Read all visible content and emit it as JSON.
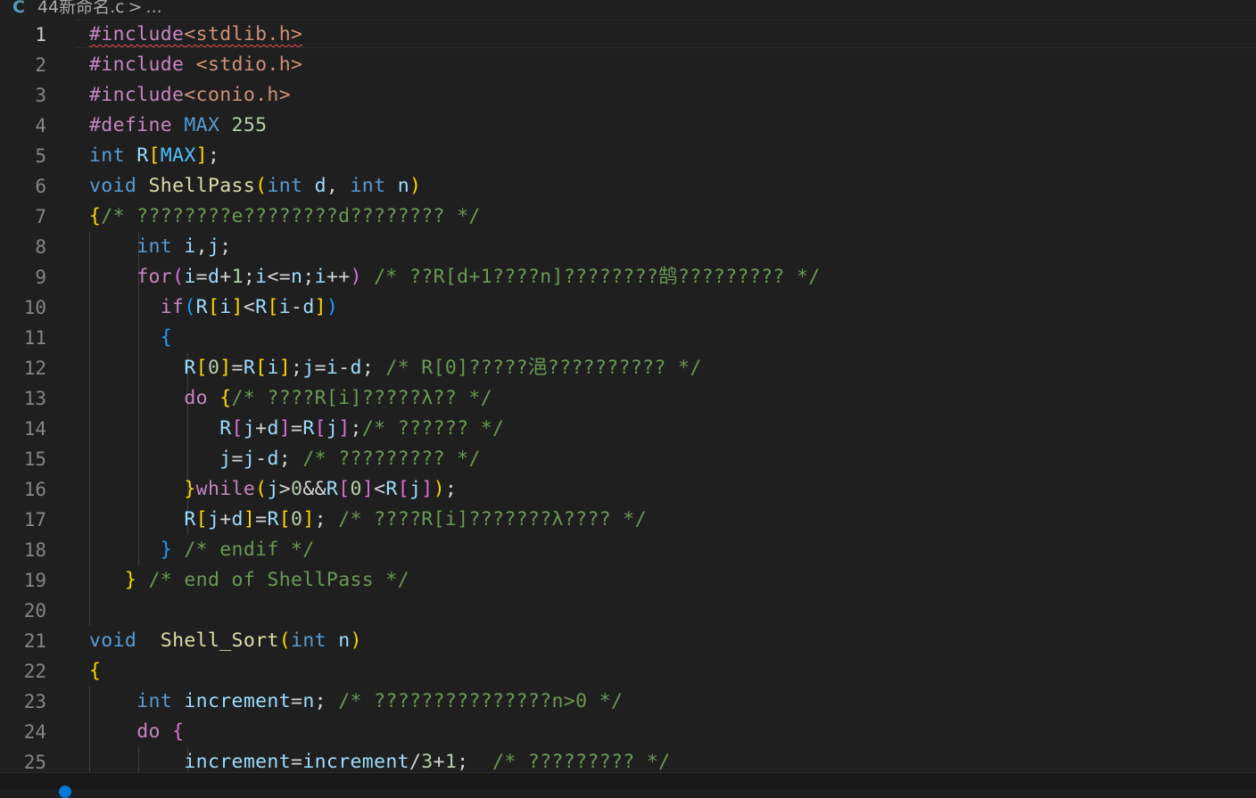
{
  "breadcrumb": {
    "icon": "C",
    "filename": "44新命名.c",
    "separator": ">",
    "more": "..."
  },
  "colors": {
    "keyword": "#569cd6",
    "control": "#c586c0",
    "function": "#dcdcaa",
    "variable": "#9cdcfe",
    "number": "#b5cea8",
    "string": "#ce9178",
    "comment": "#6a9955",
    "text": "#d4d4d4",
    "constant": "#4fc1ff",
    "bracket1": "#ffd700",
    "bracket2": "#da70d6",
    "bracket3": "#179fff"
  },
  "code_lines": [
    {
      "n": "1",
      "t": [
        [
          "#include",
          "control"
        ],
        [
          "<stdlib.h>",
          "string"
        ]
      ]
    },
    {
      "n": "2",
      "t": [
        [
          "#include",
          "control"
        ],
        [
          " ",
          "text"
        ],
        [
          "<stdio.h>",
          "string"
        ]
      ]
    },
    {
      "n": "3",
      "t": [
        [
          "#include",
          "control"
        ],
        [
          "<conio.h>",
          "string"
        ]
      ]
    },
    {
      "n": "4",
      "t": [
        [
          "#define",
          "control"
        ],
        [
          " ",
          "text"
        ],
        [
          "MAX",
          "keyword"
        ],
        [
          " ",
          "text"
        ],
        [
          "255",
          "number"
        ]
      ]
    },
    {
      "n": "5",
      "t": [
        [
          "int",
          "keyword"
        ],
        [
          " ",
          "text"
        ],
        [
          "R",
          "variable"
        ],
        [
          "[",
          "bracket1"
        ],
        [
          "MAX",
          "constant"
        ],
        [
          "]",
          "bracket1"
        ],
        [
          ";",
          "text"
        ]
      ]
    },
    {
      "n": "6",
      "t": [
        [
          "void",
          "keyword"
        ],
        [
          " ",
          "text"
        ],
        [
          "ShellPass",
          "function"
        ],
        [
          "(",
          "bracket1"
        ],
        [
          "int",
          "keyword"
        ],
        [
          " ",
          "text"
        ],
        [
          "d",
          "variable"
        ],
        [
          ", ",
          "text"
        ],
        [
          "int",
          "keyword"
        ],
        [
          " ",
          "text"
        ],
        [
          "n",
          "variable"
        ],
        [
          ")",
          "bracket1"
        ]
      ]
    },
    {
      "n": "7",
      "t": [
        [
          "{",
          "bracket1"
        ],
        [
          "/* ????????e????????d???????? */",
          "comment"
        ]
      ]
    },
    {
      "n": "8",
      "t": [
        [
          "    ",
          "text"
        ],
        [
          "int",
          "keyword"
        ],
        [
          " ",
          "text"
        ],
        [
          "i",
          "variable"
        ],
        [
          ",",
          "text"
        ],
        [
          "j",
          "variable"
        ],
        [
          ";",
          "text"
        ]
      ]
    },
    {
      "n": "9",
      "t": [
        [
          "    ",
          "text"
        ],
        [
          "for",
          "control"
        ],
        [
          "(",
          "bracket2"
        ],
        [
          "i",
          "variable"
        ],
        [
          "=",
          "text"
        ],
        [
          "d",
          "variable"
        ],
        [
          "+",
          "text"
        ],
        [
          "1",
          "number"
        ],
        [
          ";",
          "text"
        ],
        [
          "i",
          "variable"
        ],
        [
          "<=",
          "text"
        ],
        [
          "n",
          "variable"
        ],
        [
          ";",
          "text"
        ],
        [
          "i",
          "variable"
        ],
        [
          "++",
          "text"
        ],
        [
          ")",
          "bracket2"
        ],
        [
          " ",
          "text"
        ],
        [
          "/* ??R[d+1????n]????????鹄????????? */",
          "comment"
        ]
      ]
    },
    {
      "n": "10",
      "t": [
        [
          "      ",
          "text"
        ],
        [
          "if",
          "control"
        ],
        [
          "(",
          "bracket3"
        ],
        [
          "R",
          "variable"
        ],
        [
          "[",
          "bracket1"
        ],
        [
          "i",
          "variable"
        ],
        [
          "]",
          "bracket1"
        ],
        [
          "<",
          "text"
        ],
        [
          "R",
          "variable"
        ],
        [
          "[",
          "bracket1"
        ],
        [
          "i",
          "variable"
        ],
        [
          "-",
          "text"
        ],
        [
          "d",
          "variable"
        ],
        [
          "]",
          "bracket1"
        ],
        [
          ")",
          "bracket3"
        ]
      ]
    },
    {
      "n": "11",
      "t": [
        [
          "      ",
          "text"
        ],
        [
          "{",
          "bracket3"
        ]
      ]
    },
    {
      "n": "12",
      "t": [
        [
          "        ",
          "text"
        ],
        [
          "R",
          "variable"
        ],
        [
          "[",
          "bracket1"
        ],
        [
          "0",
          "number"
        ],
        [
          "]",
          "bracket1"
        ],
        [
          "=",
          "text"
        ],
        [
          "R",
          "variable"
        ],
        [
          "[",
          "bracket1"
        ],
        [
          "i",
          "variable"
        ],
        [
          "]",
          "bracket1"
        ],
        [
          ";",
          "text"
        ],
        [
          "j",
          "variable"
        ],
        [
          "=",
          "text"
        ],
        [
          "i",
          "variable"
        ],
        [
          "-",
          "text"
        ],
        [
          "d",
          "variable"
        ],
        [
          "; ",
          "text"
        ],
        [
          "/* R[0]?????浥?????????? */",
          "comment"
        ]
      ]
    },
    {
      "n": "13",
      "t": [
        [
          "        ",
          "text"
        ],
        [
          "do",
          "control"
        ],
        [
          " ",
          "text"
        ],
        [
          "{",
          "bracket1"
        ],
        [
          "/* ????R[i]?????λ?? */",
          "comment"
        ]
      ]
    },
    {
      "n": "14",
      "t": [
        [
          "           ",
          "text"
        ],
        [
          "R",
          "variable"
        ],
        [
          "[",
          "bracket2"
        ],
        [
          "j",
          "variable"
        ],
        [
          "+",
          "text"
        ],
        [
          "d",
          "variable"
        ],
        [
          "]",
          "bracket2"
        ],
        [
          "=",
          "text"
        ],
        [
          "R",
          "variable"
        ],
        [
          "[",
          "bracket2"
        ],
        [
          "j",
          "variable"
        ],
        [
          "]",
          "bracket2"
        ],
        [
          ";",
          "text"
        ],
        [
          "/* ?????? */",
          "comment"
        ]
      ]
    },
    {
      "n": "15",
      "t": [
        [
          "           ",
          "text"
        ],
        [
          "j",
          "variable"
        ],
        [
          "=",
          "text"
        ],
        [
          "j",
          "variable"
        ],
        [
          "-",
          "text"
        ],
        [
          "d",
          "variable"
        ],
        [
          "; ",
          "text"
        ],
        [
          "/* ????????? */",
          "comment"
        ]
      ]
    },
    {
      "n": "16",
      "t": [
        [
          "        ",
          "text"
        ],
        [
          "}",
          "bracket1"
        ],
        [
          "while",
          "control"
        ],
        [
          "(",
          "bracket1"
        ],
        [
          "j",
          "variable"
        ],
        [
          ">",
          "text"
        ],
        [
          "0",
          "number"
        ],
        [
          "&&",
          "text"
        ],
        [
          "R",
          "variable"
        ],
        [
          "[",
          "bracket2"
        ],
        [
          "0",
          "number"
        ],
        [
          "]",
          "bracket2"
        ],
        [
          "<",
          "text"
        ],
        [
          "R",
          "variable"
        ],
        [
          "[",
          "bracket2"
        ],
        [
          "j",
          "variable"
        ],
        [
          "]",
          "bracket2"
        ],
        [
          ")",
          "bracket1"
        ],
        [
          ";",
          "text"
        ]
      ]
    },
    {
      "n": "17",
      "t": [
        [
          "        ",
          "text"
        ],
        [
          "R",
          "variable"
        ],
        [
          "[",
          "bracket1"
        ],
        [
          "j",
          "variable"
        ],
        [
          "+",
          "text"
        ],
        [
          "d",
          "variable"
        ],
        [
          "]",
          "bracket1"
        ],
        [
          "=",
          "text"
        ],
        [
          "R",
          "variable"
        ],
        [
          "[",
          "bracket1"
        ],
        [
          "0",
          "number"
        ],
        [
          "]",
          "bracket1"
        ],
        [
          "; ",
          "text"
        ],
        [
          "/* ????R[i]???????λ???? */",
          "comment"
        ]
      ]
    },
    {
      "n": "18",
      "t": [
        [
          "      ",
          "text"
        ],
        [
          "}",
          "bracket3"
        ],
        [
          " ",
          "text"
        ],
        [
          "/* endif */",
          "comment"
        ]
      ]
    },
    {
      "n": "19",
      "t": [
        [
          "   ",
          "text"
        ],
        [
          "}",
          "bracket1"
        ],
        [
          " ",
          "text"
        ],
        [
          "/* end of ShellPass */",
          "comment"
        ]
      ]
    },
    {
      "n": "20",
      "t": []
    },
    {
      "n": "21",
      "t": [
        [
          "void",
          "keyword"
        ],
        [
          "  ",
          "text"
        ],
        [
          "Shell_Sort",
          "function"
        ],
        [
          "(",
          "bracket1"
        ],
        [
          "int",
          "keyword"
        ],
        [
          " ",
          "text"
        ],
        [
          "n",
          "variable"
        ],
        [
          ")",
          "bracket1"
        ]
      ]
    },
    {
      "n": "22",
      "t": [
        [
          "{",
          "bracket1"
        ]
      ]
    },
    {
      "n": "23",
      "t": [
        [
          "    ",
          "text"
        ],
        [
          "int",
          "keyword"
        ],
        [
          " ",
          "text"
        ],
        [
          "increment",
          "variable"
        ],
        [
          "=",
          "text"
        ],
        [
          "n",
          "variable"
        ],
        [
          "; ",
          "text"
        ],
        [
          "/* ???????????????n>0 */",
          "comment"
        ]
      ]
    },
    {
      "n": "24",
      "t": [
        [
          "    ",
          "text"
        ],
        [
          "do",
          "control"
        ],
        [
          " ",
          "text"
        ],
        [
          "{",
          "bracket2"
        ]
      ]
    },
    {
      "n": "25",
      "t": [
        [
          "        ",
          "text"
        ],
        [
          "increment",
          "variable"
        ],
        [
          "=",
          "text"
        ],
        [
          "increment",
          "variable"
        ],
        [
          "/",
          "text"
        ],
        [
          "3",
          "number"
        ],
        [
          "+",
          "text"
        ],
        [
          "1",
          "number"
        ],
        [
          ";  ",
          "text"
        ],
        [
          "/* ????????? */",
          "comment"
        ]
      ]
    }
  ]
}
